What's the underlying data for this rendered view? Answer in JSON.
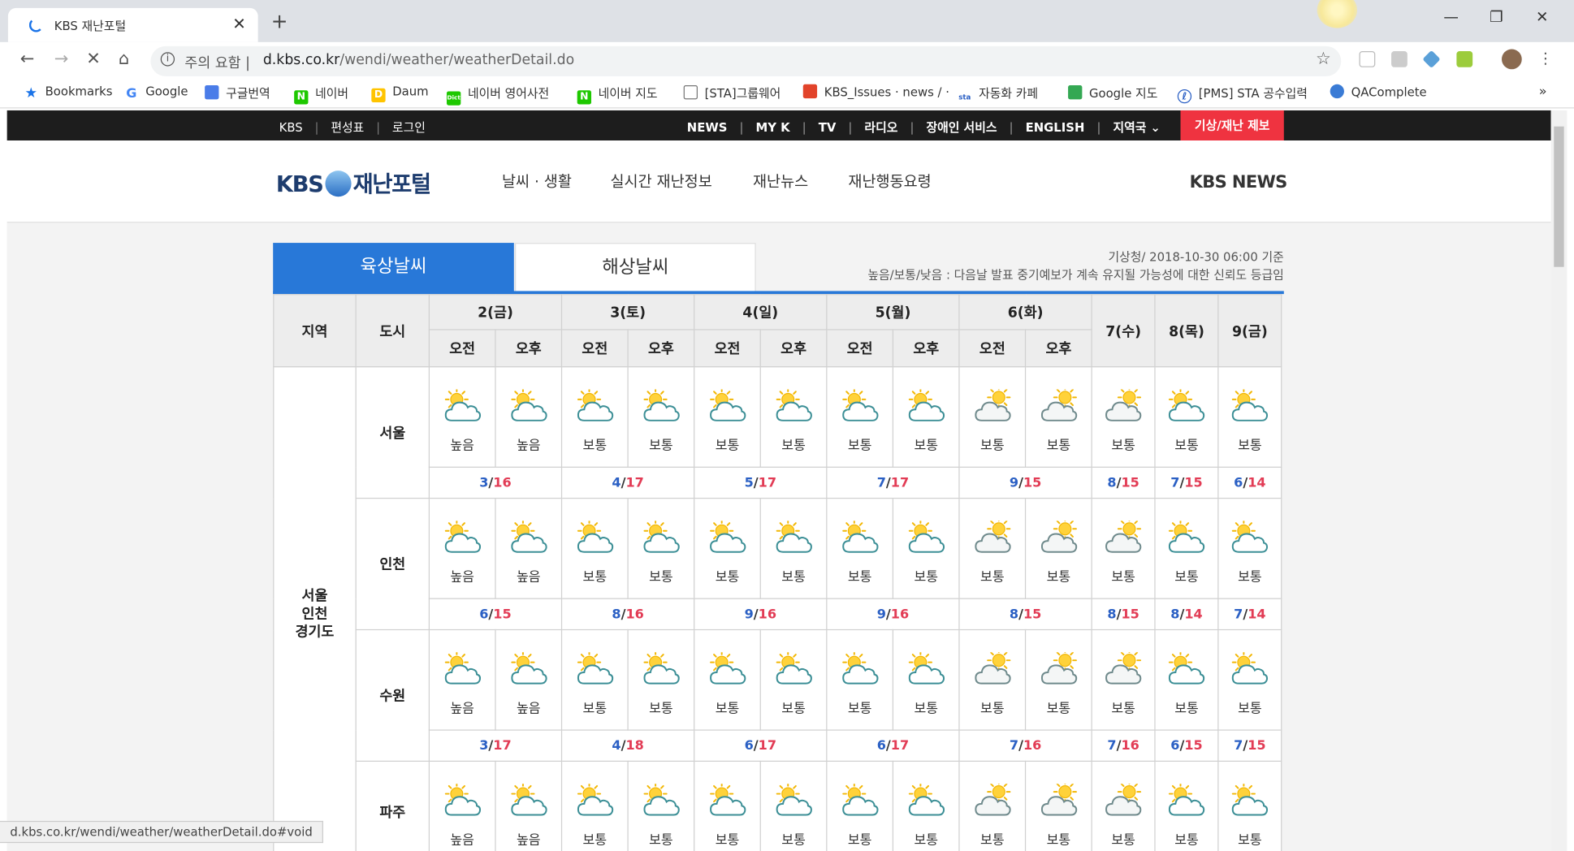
{
  "browser": {
    "tab_title": "KBS 재난포털",
    "url_warning": "주의 요함",
    "url_host": "d.kbs.co.kr",
    "url_path": "/wendi/weather/weatherDetail.do",
    "status_url": "d.kbs.co.kr/wendi/weather/weatherDetail.do#void",
    "bookmarks": [
      "Bookmarks",
      "Google",
      "구글번역",
      "네이버",
      "Daum",
      "네이버 영어사전",
      "네이버 지도",
      "[STA]그룹웨어",
      "KBS_Issues · news / ·",
      "자동화 카페",
      "Google 지도",
      "[PMS] STA 공수입력",
      "QAComplete"
    ],
    "bookmarks_more": "»"
  },
  "gnb": {
    "left": [
      "KBS",
      "편성표",
      "로그인"
    ],
    "right": [
      "NEWS",
      "MY K",
      "TV",
      "라디오",
      "장애인 서비스",
      "ENGLISH",
      "지역국"
    ],
    "alert": "기상/재난 제보"
  },
  "header": {
    "logo_kbs": "KBS",
    "logo_text": "재난포털",
    "menu": [
      "날씨 · 생활",
      "실시간 재난정보",
      "재난뉴스",
      "재난행동요령"
    ],
    "kbs_news": "KBS NEWS"
  },
  "weather": {
    "tab_land": "육상날씨",
    "tab_sea": "해상날씨",
    "source_note": "기상청/ 2018-10-30 06:00 기준",
    "reliability_note": "높음/보통/낮음 : 다음날 발표 중기예보가 계속 유지될 가능성에 대한 신뢰도 등급임",
    "col_region": "지역",
    "col_city": "도시",
    "days_split": [
      "2(금)",
      "3(토)",
      "4(일)",
      "5(월)",
      "6(화)"
    ],
    "days_single": [
      "7(수)",
      "8(목)",
      "9(금)"
    ],
    "am": "오전",
    "pm": "오후",
    "region": "서울\n인천\n경기도",
    "cities": [
      {
        "name": "서울",
        "icons": [
          "sun-cloud",
          "sun-cloud",
          "sun-cloud",
          "sun-cloud",
          "sun-cloud",
          "sun-cloud",
          "sun-cloud",
          "sun-cloud",
          "cloud-sun",
          "cloud-sun",
          "cloud-sun",
          "sun-cloud",
          "sun-cloud"
        ],
        "reliability": [
          "높음",
          "높음",
          "보통",
          "보통",
          "보통",
          "보통",
          "보통",
          "보통",
          "보통",
          "보통",
          "보통",
          "보통",
          "보통"
        ],
        "temps": [
          [
            "3",
            "16"
          ],
          [
            "4",
            "17"
          ],
          [
            "5",
            "17"
          ],
          [
            "7",
            "17"
          ],
          [
            "9",
            "15"
          ],
          [
            "8",
            "15"
          ],
          [
            "7",
            "15"
          ],
          [
            "6",
            "14"
          ]
        ]
      },
      {
        "name": "인천",
        "icons": [
          "sun-cloud",
          "sun-cloud",
          "sun-cloud",
          "sun-cloud",
          "sun-cloud",
          "sun-cloud",
          "sun-cloud",
          "sun-cloud",
          "cloud-sun",
          "cloud-sun",
          "cloud-sun",
          "sun-cloud",
          "sun-cloud"
        ],
        "reliability": [
          "높음",
          "높음",
          "보통",
          "보통",
          "보통",
          "보통",
          "보통",
          "보통",
          "보통",
          "보통",
          "보통",
          "보통",
          "보통"
        ],
        "temps": [
          [
            "6",
            "15"
          ],
          [
            "8",
            "16"
          ],
          [
            "9",
            "16"
          ],
          [
            "9",
            "16"
          ],
          [
            "8",
            "15"
          ],
          [
            "8",
            "15"
          ],
          [
            "8",
            "14"
          ],
          [
            "7",
            "14"
          ]
        ]
      },
      {
        "name": "수원",
        "icons": [
          "sun-cloud",
          "sun-cloud",
          "sun-cloud",
          "sun-cloud",
          "sun-cloud",
          "sun-cloud",
          "sun-cloud",
          "sun-cloud",
          "cloud-sun",
          "cloud-sun",
          "cloud-sun",
          "sun-cloud",
          "sun-cloud"
        ],
        "reliability": [
          "높음",
          "높음",
          "보통",
          "보통",
          "보통",
          "보통",
          "보통",
          "보통",
          "보통",
          "보통",
          "보통",
          "보통",
          "보통"
        ],
        "temps": [
          [
            "3",
            "17"
          ],
          [
            "4",
            "18"
          ],
          [
            "6",
            "17"
          ],
          [
            "6",
            "17"
          ],
          [
            "7",
            "16"
          ],
          [
            "7",
            "16"
          ],
          [
            "6",
            "15"
          ],
          [
            "7",
            "15"
          ]
        ]
      },
      {
        "name": "파주",
        "icons": [
          "sun-cloud",
          "sun-cloud",
          "sun-cloud",
          "sun-cloud",
          "sun-cloud",
          "sun-cloud",
          "sun-cloud",
          "sun-cloud",
          "cloud-sun",
          "cloud-sun",
          "cloud-sun",
          "sun-cloud",
          "sun-cloud"
        ],
        "reliability": [
          "높음",
          "높음",
          "보통",
          "보통",
          "보통",
          "보통",
          "보통",
          "보통",
          "보통",
          "보통",
          "보통",
          "보통",
          "보통"
        ],
        "temps": []
      }
    ]
  },
  "colors": {
    "primary": "#2878d8",
    "alert": "#ef3340",
    "temp_low": "#2b60c4",
    "temp_high": "#e23c55"
  }
}
